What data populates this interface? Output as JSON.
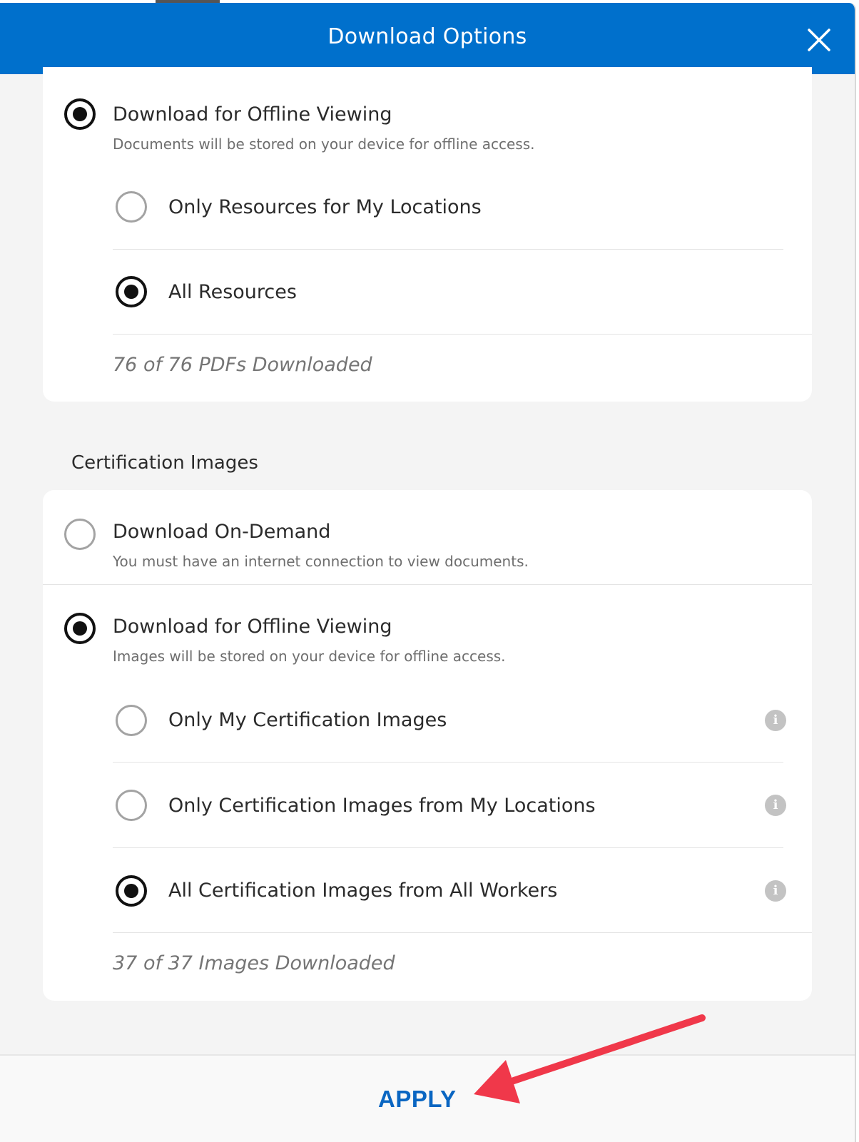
{
  "modal": {
    "title": "Download Options",
    "close_icon": "close-icon"
  },
  "documents_card": {
    "offline_option": {
      "title": "Download for Offline Viewing",
      "description": "Documents will be stored on your device for offline access.",
      "selected": true
    },
    "sub_options": [
      {
        "label": "Only Resources for My Locations",
        "selected": false
      },
      {
        "label": "All Resources",
        "selected": true
      }
    ],
    "status": "76 of 76 PDFs Downloaded"
  },
  "certification_images": {
    "heading": "Certification Images",
    "on_demand_option": {
      "title": "Download On-Demand",
      "description": "You must have an internet connection to view documents.",
      "selected": false
    },
    "offline_option": {
      "title": "Download for Offline Viewing",
      "description": "Images will be stored on your device for offline access.",
      "selected": true
    },
    "sub_options": [
      {
        "label": "Only My Certification Images",
        "selected": false,
        "info_icon": "info-icon"
      },
      {
        "label": "Only Certification Images from My Locations",
        "selected": false,
        "info_icon": "info-icon"
      },
      {
        "label": "All Certification Images from All Workers",
        "selected": true,
        "info_icon": "info-icon"
      }
    ],
    "status": "37 of 37 Images Downloaded"
  },
  "footer": {
    "apply_label": "APPLY"
  },
  "colors": {
    "header_blue": "#0070cc",
    "apply_blue": "#0a66c2",
    "annotation_arrow": "#f0384a"
  }
}
